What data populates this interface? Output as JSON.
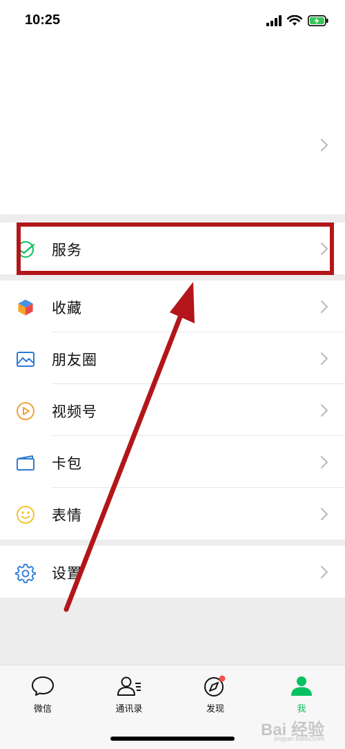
{
  "status_bar": {
    "time": "10:25"
  },
  "menu_service": {
    "label": "服务"
  },
  "menu_items": [
    {
      "label": "收藏",
      "icon": "favorites-cube-icon"
    },
    {
      "label": "朋友圈",
      "icon": "moments-photo-icon"
    },
    {
      "label": "视频号",
      "icon": "channels-play-icon"
    },
    {
      "label": "卡包",
      "icon": "card-wallet-icon"
    },
    {
      "label": "表情",
      "icon": "sticker-smile-icon"
    }
  ],
  "menu_settings": {
    "label": "设置"
  },
  "tabbar": {
    "tabs": [
      {
        "label": "微信",
        "icon": "chat-bubble-icon"
      },
      {
        "label": "通讯录",
        "icon": "contacts-icon"
      },
      {
        "label": "发现",
        "icon": "compass-icon"
      },
      {
        "label": "我",
        "icon": "person-icon"
      }
    ],
    "active_index": 3
  },
  "watermark": {
    "main": "Bai 经验",
    "sub": "jingyan.baidu.com"
  },
  "colors": {
    "accent_green": "#07c160",
    "highlight_red": "#b3161a",
    "badge_red": "#fa5151"
  }
}
